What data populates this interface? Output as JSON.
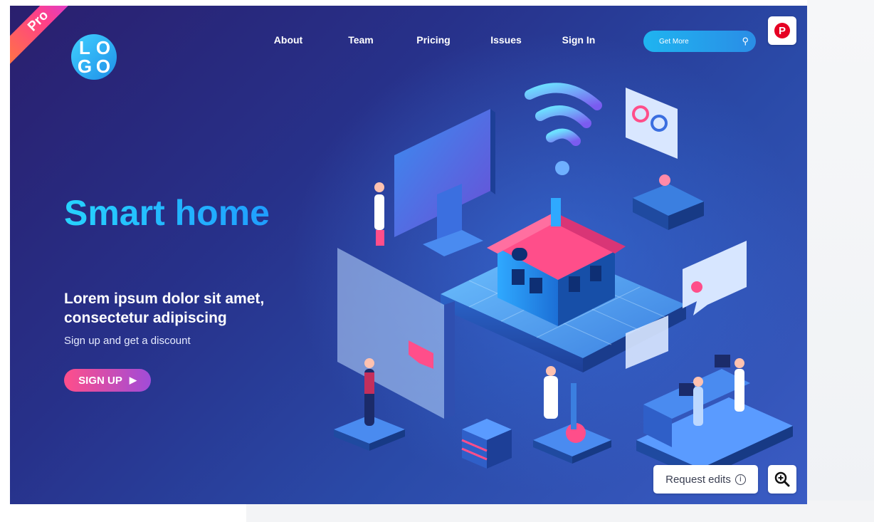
{
  "ribbon": {
    "label": "Pro"
  },
  "logo": {
    "letters": [
      "L",
      "O",
      "G",
      "O"
    ]
  },
  "nav": {
    "items": [
      {
        "label": "About"
      },
      {
        "label": "Team"
      },
      {
        "label": "Pricing"
      },
      {
        "label": "Issues"
      },
      {
        "label": "Sign In"
      }
    ]
  },
  "search": {
    "placeholder": "Get More",
    "icon": "search-icon"
  },
  "hero": {
    "title": "Smart home",
    "subtitle": "Lorem ipsum dolor sit amet, consectetur adipiscing",
    "note": "Sign up and get a discount",
    "cta_label": "SIGN UP"
  },
  "overlay": {
    "pinterest_icon": "pinterest-icon",
    "request_edits_label": "Request edits",
    "zoom_icon": "zoom-in-icon"
  },
  "colors": {
    "bg_dark": "#2a1f6e",
    "bg_light": "#3a5cc4",
    "accent_cyan": "#27d3ff",
    "accent_pink": "#ff4e8a"
  }
}
